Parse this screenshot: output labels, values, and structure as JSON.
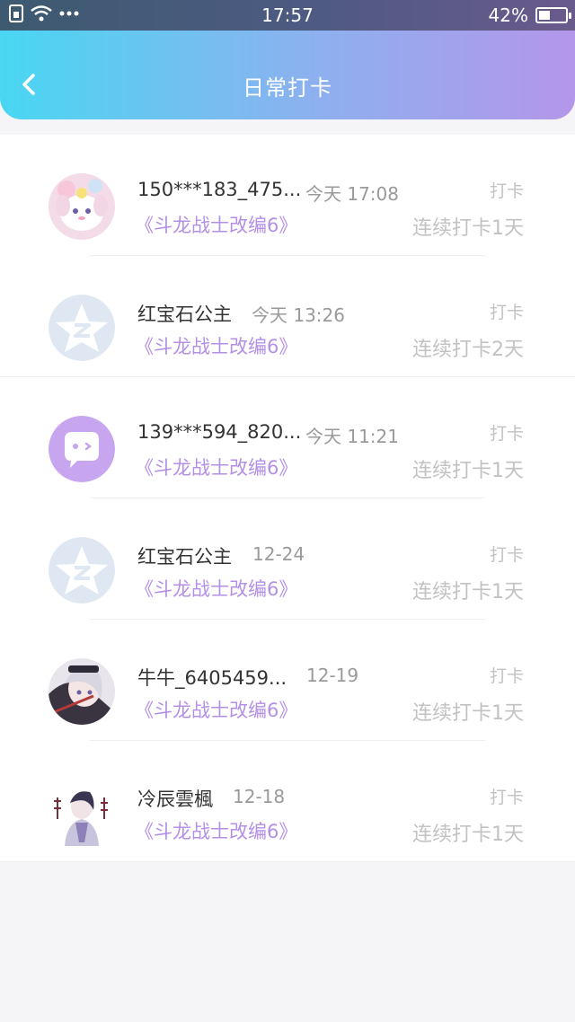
{
  "status_bar": {
    "time": "17:57",
    "battery": "42%",
    "battery_level": 0.42
  },
  "header": {
    "title": "日常打卡",
    "back_icon": "chevron-left-icon"
  },
  "colors": {
    "header_gradient_start": "#49d7f2",
    "header_gradient_end": "#b496ea",
    "book_title": "#b48fe6",
    "secondary_text": "#c2c2c2"
  },
  "entries": [
    {
      "name": "150***183_475...",
      "time": "今天 17:08",
      "book": "《斗龙战士改编6》",
      "label": "打卡",
      "streak": "连续打卡1天",
      "avatar": "anime-plush-avatar"
    },
    {
      "name": "红宝石公主",
      "time": "今天 13:26",
      "book": "《斗龙战士改编6》",
      "label": "打卡",
      "streak": "连续打卡2天",
      "avatar": "default-star-avatar"
    },
    {
      "name": "139***594_820...",
      "time": "今天 11:21",
      "book": "《斗龙战士改编6》",
      "label": "打卡",
      "streak": "连续打卡1天",
      "avatar": "chat-bubble-avatar"
    },
    {
      "name": "红宝石公主",
      "time": "12-24",
      "book": "《斗龙战士改编6》",
      "label": "打卡",
      "streak": "连续打卡1天",
      "avatar": "default-star-avatar"
    },
    {
      "name": "牛牛_6405459...",
      "time": "12-19",
      "book": "《斗龙战士改编6》",
      "label": "打卡",
      "streak": "连续打卡1天",
      "avatar": "anime-girl-avatar"
    },
    {
      "name": "冷辰雲楓",
      "time": "12-18",
      "book": "《斗龙战士改编6》",
      "label": "打卡",
      "streak": "连续打卡1天",
      "avatar": "anime-character-avatar"
    }
  ]
}
